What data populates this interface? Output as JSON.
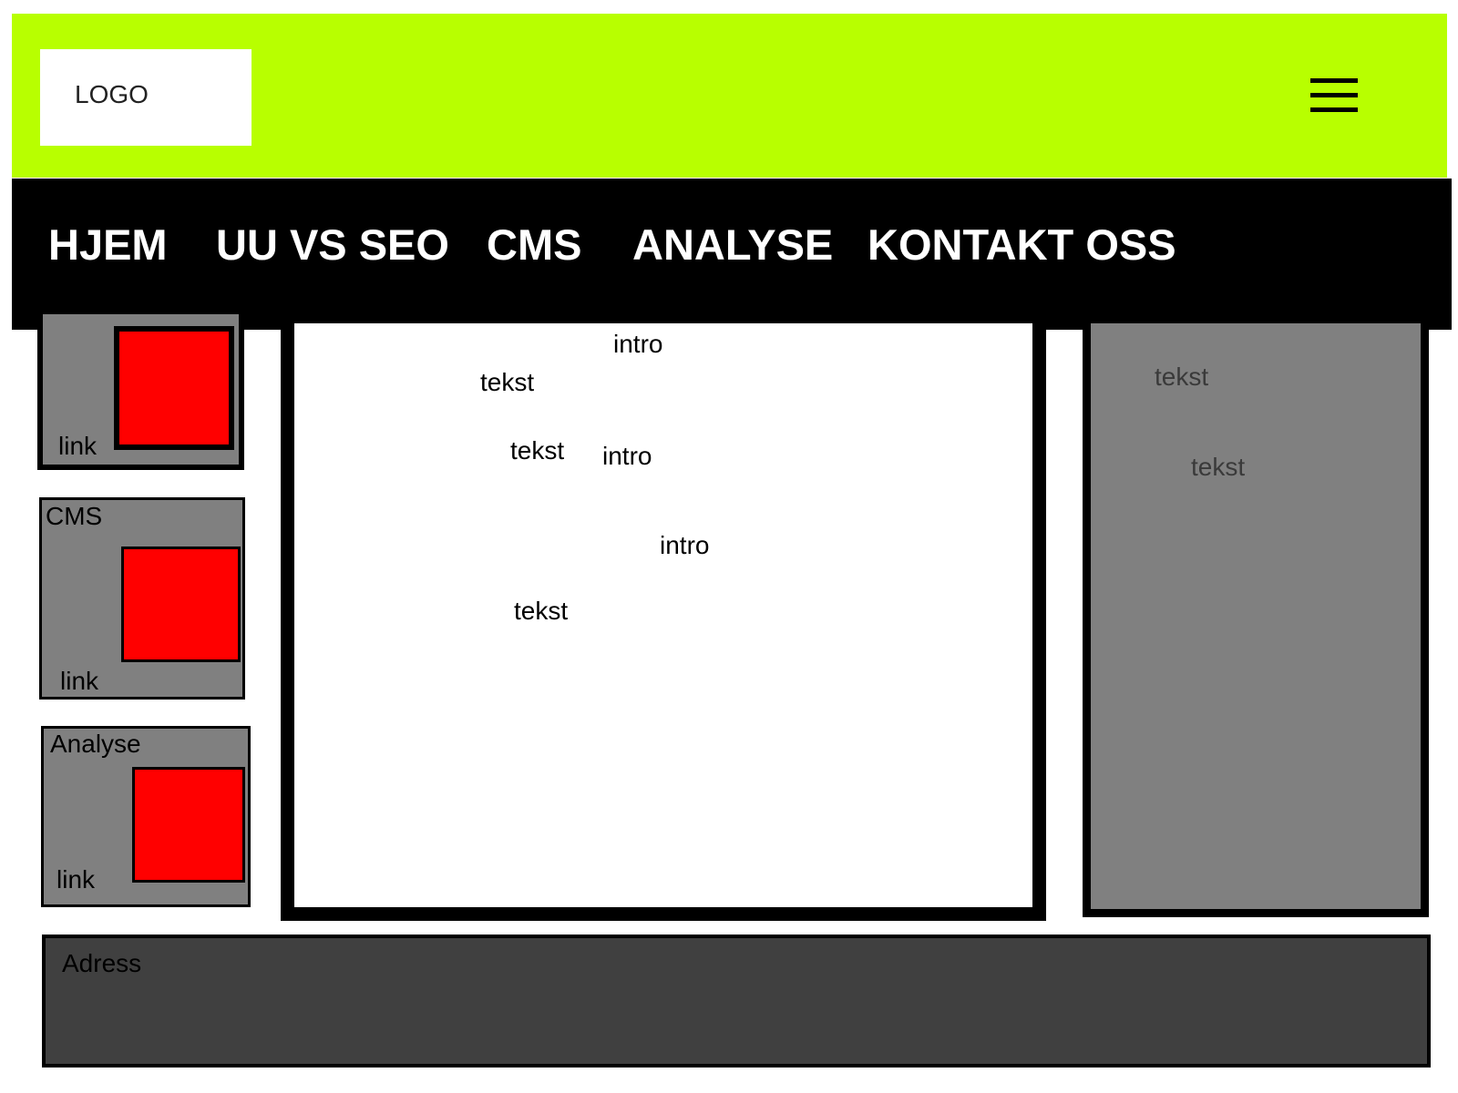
{
  "header": {
    "logo": "LOGO",
    "menu_icon": "hamburger-menu-icon"
  },
  "nav": {
    "items": [
      {
        "label": "HJEM"
      },
      {
        "label": "UU VS SEO"
      },
      {
        "label": "CMS"
      },
      {
        "label": "ANALYSE"
      },
      {
        "label": "KONTAKT OSS"
      }
    ]
  },
  "sidebar": {
    "cards": [
      {
        "title": "",
        "link": "link"
      },
      {
        "title": "CMS",
        "link": "link"
      },
      {
        "title": "Analyse",
        "link": "link"
      }
    ]
  },
  "main": {
    "texts": [
      "intro",
      "tekst",
      "tekst",
      "intro",
      "intro",
      "tekst"
    ]
  },
  "aside": {
    "texts": [
      "tekst",
      "tekst"
    ]
  },
  "footer": {
    "address": "Adress"
  },
  "colors": {
    "header_bg": "#b8ff00",
    "nav_bg": "#000000",
    "card_bg": "#808080",
    "image_placeholder": "#ff0000",
    "footer_bg": "#404040"
  }
}
